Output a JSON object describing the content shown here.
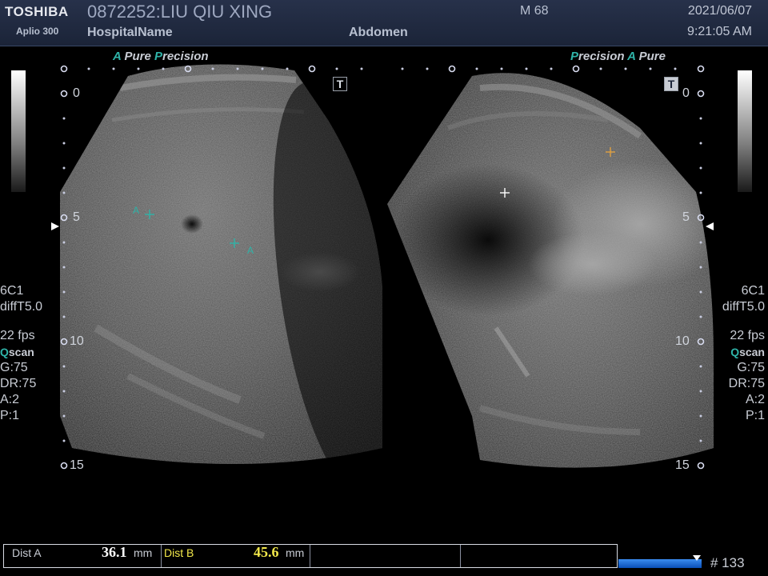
{
  "header": {
    "brand": "TOSHIBA",
    "model": "Aplio 300",
    "patient": "0872252:LIU QIU XING",
    "hospital": "HospitalName",
    "mode_index": "M 68",
    "study": "Abdomen",
    "date": "2021/06/07",
    "time": "9:21:05 AM"
  },
  "left_image": {
    "preset_a": "A",
    "preset_pure": "Pure",
    "preset_p": "P",
    "preset_precision": "recision",
    "t_marker": "T",
    "depth_labels": [
      "0",
      "5",
      "10",
      "15"
    ],
    "caliper_label_1": "A",
    "caliper_label_2": "A"
  },
  "right_image": {
    "preset_p": "P",
    "preset_precision": "recision",
    "preset_a": "A",
    "preset_pure": "Pure",
    "t_marker": "T",
    "depth_labels": [
      "0",
      "5",
      "10",
      "15"
    ]
  },
  "side_left": {
    "probe": "6C1",
    "filter": "diffT5.0",
    "fps": "22 fps",
    "qscan_q": "Q",
    "qscan_rest": "scan",
    "gain": "G:75",
    "dr": "DR:75",
    "a": "A:2",
    "p": "P:1"
  },
  "side_right": {
    "probe": "6C1",
    "filter": "diffT5.0",
    "fps": "22 fps",
    "qscan_q": "Q",
    "qscan_rest": "scan",
    "gain": "G:75",
    "dr": "DR:75",
    "a": "A:2",
    "p": "P:1"
  },
  "measurements": [
    {
      "label": "Dist A",
      "value": "36.1",
      "unit": "mm",
      "value_color": "#ffffff"
    },
    {
      "label": "Dist B",
      "value": "45.6",
      "unit": "mm",
      "value_color": "#f2e84a"
    }
  ],
  "frame_counter": "# 133",
  "colors": {
    "accent_teal": "#2fb3a8",
    "caliper_orange": "#e0a040",
    "header_bg": "#1b2438"
  }
}
